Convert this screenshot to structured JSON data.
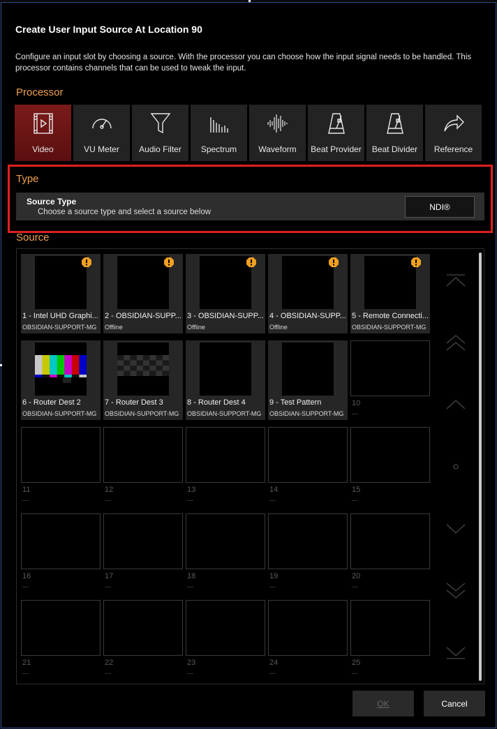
{
  "dialog": {
    "title": "Create User Input Source At Location 90",
    "description": "Configure an input slot by choosing a source. With the processor you can choose how the input signal needs to be handled. This processor contains channels that can be used to tweak the input."
  },
  "processor": {
    "label": "Processor",
    "items": [
      {
        "label": "Video",
        "icon": "video-icon",
        "active": true
      },
      {
        "label": "VU Meter",
        "icon": "gauge-icon",
        "active": false
      },
      {
        "label": "Audio Filter",
        "icon": "funnel-icon",
        "active": false
      },
      {
        "label": "Spectrum",
        "icon": "spectrum-icon",
        "active": false
      },
      {
        "label": "Waveform",
        "icon": "waveform-icon",
        "active": false
      },
      {
        "label": "Beat Provider",
        "icon": "metronome-icon",
        "active": false
      },
      {
        "label": "Beat Divider",
        "icon": "metronome-icon",
        "active": false
      },
      {
        "label": "Reference",
        "icon": "share-arrow-icon",
        "active": false
      }
    ]
  },
  "type": {
    "label": "Type",
    "source_type_title": "Source Type",
    "source_type_desc": "Choose a source type and select a source below",
    "value": "NDI®"
  },
  "source": {
    "label": "Source",
    "tiles": [
      {
        "name": "1 - Intel UHD Graphi...",
        "sub": "OBSIDIAN-SUPPORT-MG",
        "state": "warn"
      },
      {
        "name": "2 - OBSIDIAN-SUPP...",
        "sub": "Offline",
        "state": "warn"
      },
      {
        "name": "3 - OBSIDIAN-SUPP...",
        "sub": "Offline",
        "state": "warn"
      },
      {
        "name": "4 - OBSIDIAN-SUPP...",
        "sub": "Offline",
        "state": "warn"
      },
      {
        "name": "5 - Remote Connecti...",
        "sub": "OBSIDIAN-SUPPORT-MG",
        "state": "warn"
      },
      {
        "name": "6 - Router Dest 2",
        "sub": "OBSIDIAN-SUPPORT-MG",
        "state": "bars"
      },
      {
        "name": "7 - Router Dest 3",
        "sub": "OBSIDIAN-SUPPORT-MG",
        "state": "checker"
      },
      {
        "name": "8 - Router Dest 4",
        "sub": "OBSIDIAN-SUPPORT-MG",
        "state": "black"
      },
      {
        "name": "9 - Test Pattern",
        "sub": "OBSIDIAN-SUPPORT-MG",
        "state": "black"
      },
      {
        "name": "10",
        "sub": "---",
        "state": "empty"
      },
      {
        "name": "11",
        "sub": "---",
        "state": "empty"
      },
      {
        "name": "12",
        "sub": "---",
        "state": "empty"
      },
      {
        "name": "13",
        "sub": "---",
        "state": "empty"
      },
      {
        "name": "14",
        "sub": "---",
        "state": "empty"
      },
      {
        "name": "15",
        "sub": "---",
        "state": "empty"
      },
      {
        "name": "16",
        "sub": "---",
        "state": "empty"
      },
      {
        "name": "17",
        "sub": "---",
        "state": "empty"
      },
      {
        "name": "18",
        "sub": "---",
        "state": "empty"
      },
      {
        "name": "19",
        "sub": "---",
        "state": "empty"
      },
      {
        "name": "20",
        "sub": "---",
        "state": "empty"
      },
      {
        "name": "21",
        "sub": "---",
        "state": "empty"
      },
      {
        "name": "22",
        "sub": "---",
        "state": "empty"
      },
      {
        "name": "23",
        "sub": "---",
        "state": "empty"
      },
      {
        "name": "24",
        "sub": "---",
        "state": "empty"
      },
      {
        "name": "25",
        "sub": "---",
        "state": "empty"
      }
    ]
  },
  "nav": [
    "first-page-icon",
    "page-up-icon",
    "line-up-icon",
    "center-dot-icon",
    "line-down-icon",
    "page-down-icon",
    "last-page-icon"
  ],
  "buttons": {
    "ok": "OK",
    "cancel": "Cancel"
  },
  "colors": {
    "accent": "#f0a04b",
    "active": "#7a1a1a",
    "highlight": "#e02020",
    "warn": "#f0a020"
  }
}
